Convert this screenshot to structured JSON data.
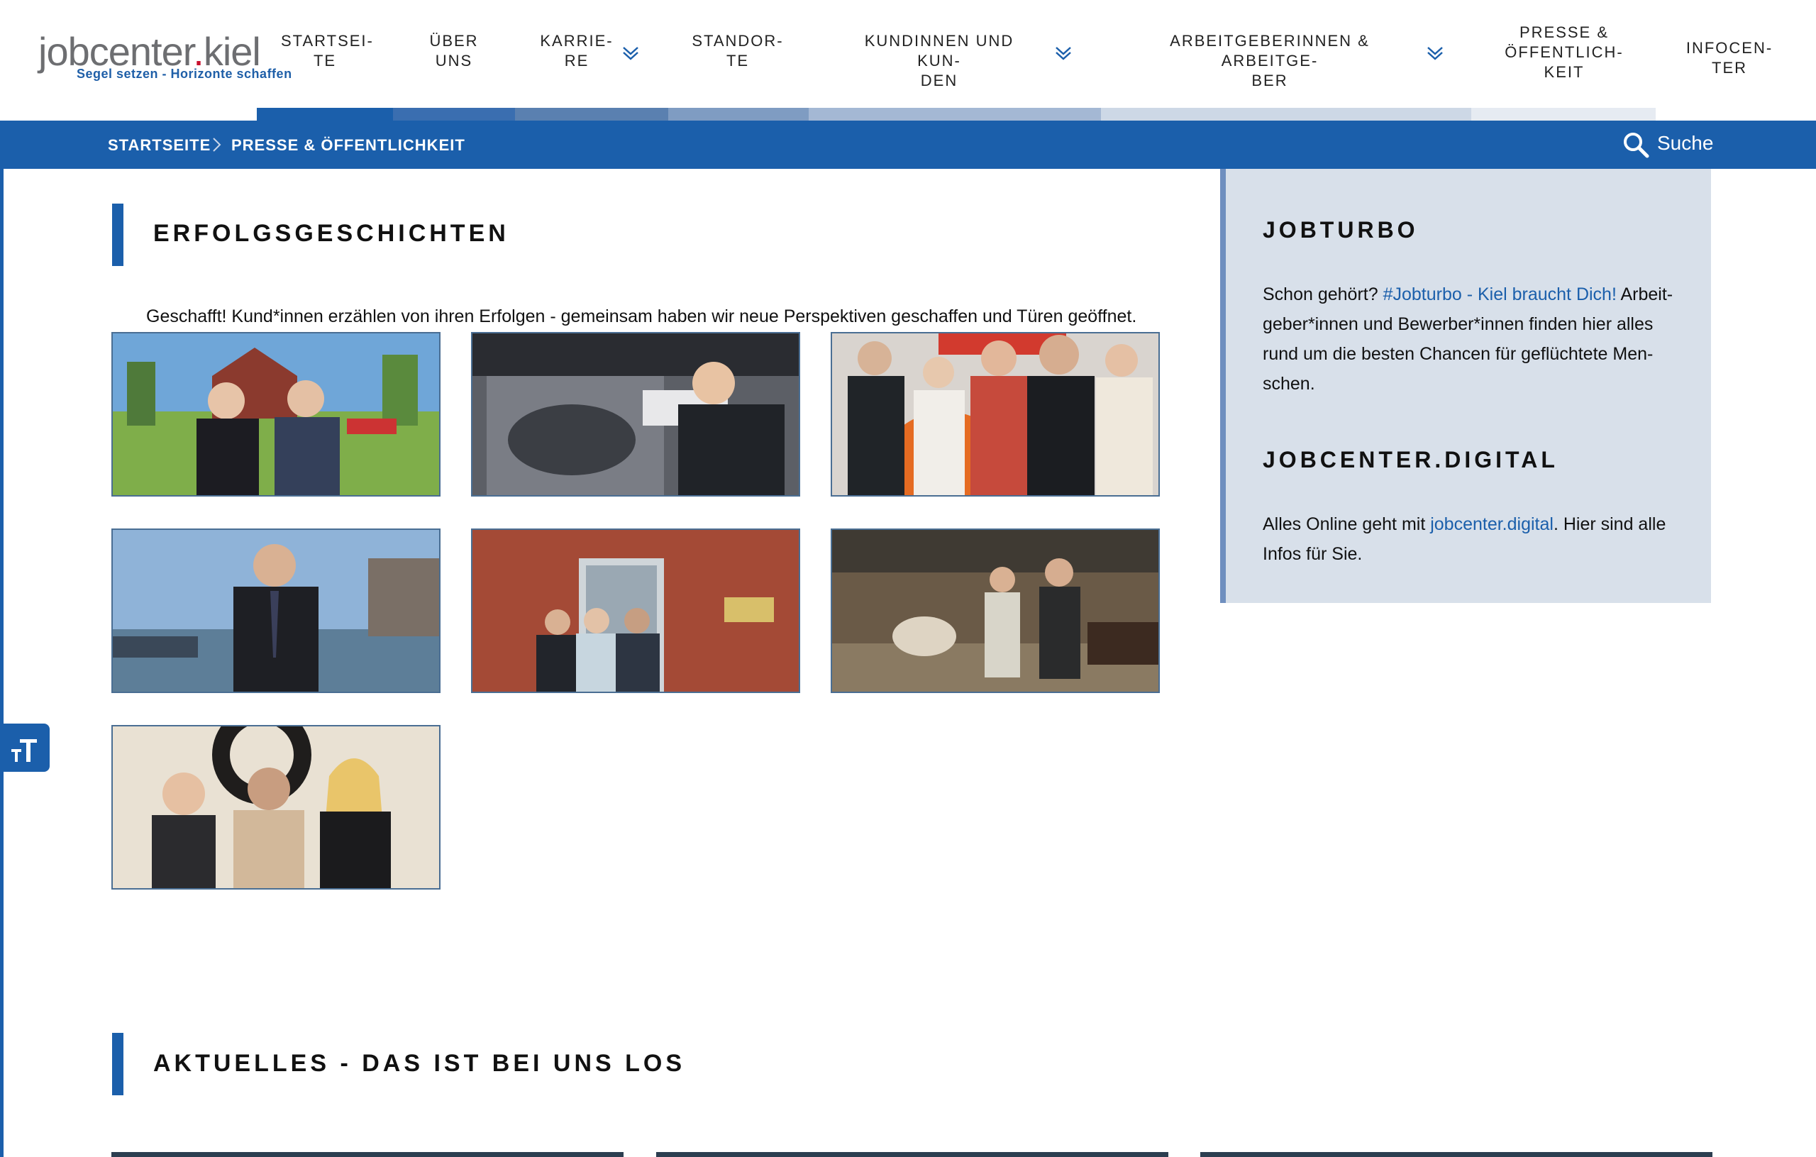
{
  "logo": {
    "main_left": "jobcenter",
    "main_dot": ".",
    "main_right": "kiel",
    "tagline": "Segel setzen - Horizonte schaffen"
  },
  "nav": [
    {
      "label_line1": "STARTSEI-",
      "label_line2": "TE",
      "label_line3": "",
      "has_dropdown": false
    },
    {
      "label_line1": "ÜBER",
      "label_line2": "UNS",
      "label_line3": "",
      "has_dropdown": false
    },
    {
      "label_line1": "KARRIE-",
      "label_line2": "RE",
      "label_line3": "",
      "has_dropdown": true
    },
    {
      "label_line1": "STANDOR-",
      "label_line2": "TE",
      "label_line3": "",
      "has_dropdown": false
    },
    {
      "label_line1": "KUNDINNEN UND KUN-",
      "label_line2": "DEN",
      "label_line3": "",
      "has_dropdown": true
    },
    {
      "label_line1": "ARBEITGEBERINNEN & ARBEITGE-",
      "label_line2": "BER",
      "label_line3": "",
      "has_dropdown": true
    },
    {
      "label_line1": "PRESSE &",
      "label_line2": "ÖFFENTLICH-",
      "label_line3": "KEIT",
      "has_dropdown": false
    },
    {
      "label_line1": "INFOCEN-",
      "label_line2": "TER",
      "label_line3": "",
      "has_dropdown": false
    }
  ],
  "breadcrumb": {
    "items": [
      "STARTSEITE",
      "PRESSE & ÖFFENTLICHKEIT"
    ]
  },
  "search": {
    "label": "Suche"
  },
  "main": {
    "section1_title": "ERFOLGSGESCHICHTEN",
    "intro": "Geschafft! Kund*innen erzählen von ihren Erfolgen - gemeinsam haben wir neue Perspektiven geschaffen und Türen geöffnet.",
    "section2_title": "AKTUELLES - DAS IST BEI UNS LOS"
  },
  "sidebar": {
    "jobturbo_title": "JOBTURBO",
    "jobturbo_text_before": "Schon gehört? ",
    "jobturbo_link": "#Jobturbo - Kiel braucht Dich!",
    "jobturbo_text_after": " Arbeit-geber*innen und Bewerber*innen finden hier alles rund um die besten Chancen für geflüchtete Men-schen.",
    "digital_title": "JOBCENTER.DIGITAL",
    "digital_text_before": "Alles Online geht mit ",
    "digital_link": "jobcenter.digital",
    "digital_text_after": ". Hier sind alle Infos für Sie."
  },
  "colors": {
    "brand_blue": "#1b5fab",
    "sidebar_bg": "#d8e0ea",
    "logo_red": "#c8102e"
  },
  "icons": {
    "search": "search-icon",
    "dropdown": "chevron-double-down-icon",
    "breadcrumb_sep": "chevron-right-icon",
    "text_size": "text-size-icon"
  }
}
